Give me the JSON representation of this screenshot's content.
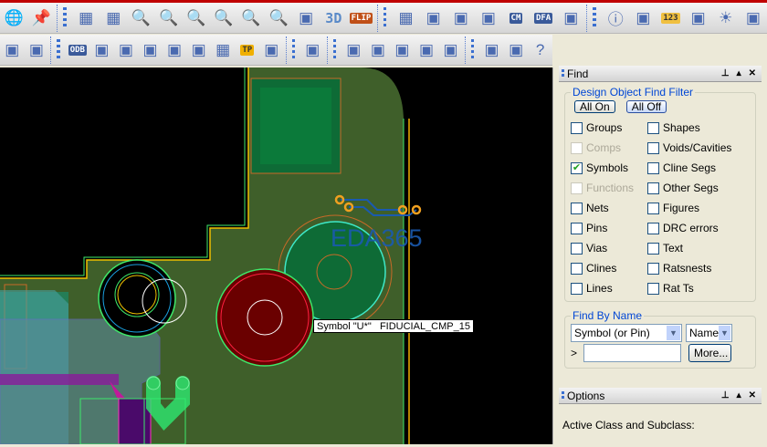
{
  "toolbar_row1": [
    "globe-icon",
    "pushpin-icon",
    "grid-view-icon",
    "grid-lines-icon",
    "zoom-window-icon",
    "zoom-fit-icon",
    "zoom-in-icon",
    "zoom-out-icon",
    "zoom-previous-icon",
    "zoom-selection-icon",
    "redraw-icon",
    "3d-view-icon",
    "flip-board-icon",
    "grid-icon",
    "color-layers-icon",
    "color-assign-icon",
    "layer-stack-icon",
    "constraint-manager-icon",
    "dfa-icon",
    "world-view-icon",
    "info-icon",
    "report-icon",
    "measure-icon",
    "shadow-brush-icon",
    "highlight-sun-icon",
    "dim-icon"
  ],
  "toolbar_row1_labels": {
    "threed": "3D",
    "flip": "FLIP",
    "cm": "CM",
    "dfa": "DFA",
    "measure": "123"
  },
  "toolbar_row2": [
    "add-connect-icon",
    "dimension-icon",
    "odb-export-icon",
    "pad-stack-icon",
    "pad-edit-icon",
    "snapshot-icon",
    "reference-designator-icon",
    "padstack-list-icon",
    "placement-grid-icon",
    "testpoint-icon",
    "symbol-array-icon",
    "route-icon",
    "signal-report-icon",
    "signal-book-icon",
    "signal-model-icon",
    "signal-check-icon",
    "signal-probe-icon",
    "copy-windows-icon",
    "bookmark-icon",
    "help-icon"
  ],
  "toolbar_row2_labels": {
    "odb": "ODB",
    "tp": "TP"
  },
  "canvas": {
    "watermark": "EDA365",
    "tooltip": "Symbol \"U*\"   FIDUCIAL_CMP_15"
  },
  "find": {
    "title": "Find",
    "filter_legend": "Design Object Find Filter",
    "all_on": "All On",
    "all_off": "All Off",
    "left": [
      {
        "label": "Groups",
        "checked": false,
        "enabled": true
      },
      {
        "label": "Comps",
        "checked": false,
        "enabled": false
      },
      {
        "label": "Symbols",
        "checked": true,
        "enabled": true
      },
      {
        "label": "Functions",
        "checked": false,
        "enabled": false
      },
      {
        "label": "Nets",
        "checked": false,
        "enabled": true
      },
      {
        "label": "Pins",
        "checked": false,
        "enabled": true
      },
      {
        "label": "Vias",
        "checked": false,
        "enabled": true
      },
      {
        "label": "Clines",
        "checked": false,
        "enabled": true
      },
      {
        "label": "Lines",
        "checked": false,
        "enabled": true
      }
    ],
    "right": [
      {
        "label": "Shapes",
        "checked": false
      },
      {
        "label": "Voids/Cavities",
        "checked": false
      },
      {
        "label": "Cline Segs",
        "checked": false
      },
      {
        "label": "Other Segs",
        "checked": false
      },
      {
        "label": "Figures",
        "checked": false
      },
      {
        "label": "DRC errors",
        "checked": false
      },
      {
        "label": "Text",
        "checked": false
      },
      {
        "label": "Ratsnests",
        "checked": false
      },
      {
        "label": "Rat Ts",
        "checked": false
      }
    ],
    "by_name_legend": "Find By Name",
    "type_select": "Symbol (or Pin)",
    "name_select": "Name",
    "prompt": ">",
    "name_value": "",
    "more": "More..."
  },
  "options": {
    "title": "Options",
    "active_class": "Active Class and Subclass:"
  },
  "colors": {
    "board": "#3f5f2a",
    "accent": "#0046d5"
  }
}
